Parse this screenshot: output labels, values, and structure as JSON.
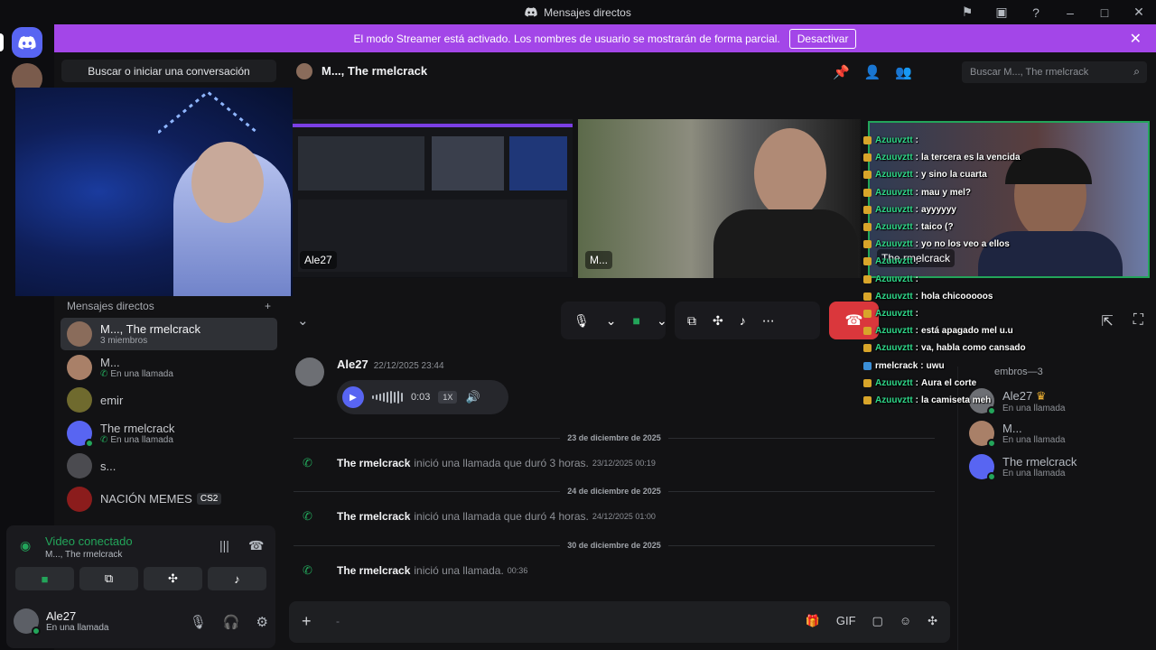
{
  "window": {
    "title": "Mensajes directos"
  },
  "banner": {
    "text": "El modo Streamer está activado. Los nombres de usuario se mostrarán de forma parcial.",
    "button": "Desactivar"
  },
  "sidebar": {
    "search_placeholder": "Buscar o iniciar una conversación",
    "dm_header": "Mensajes directos",
    "dms": [
      {
        "name": "M..., The rmelcrack",
        "sub": "3 miembros"
      },
      {
        "name": "M...",
        "sub": "En una llamada"
      },
      {
        "name": "emir",
        "sub": ""
      },
      {
        "name": "The rmelcrack",
        "sub": "En una llamada"
      },
      {
        "name": "s...",
        "sub": ""
      },
      {
        "name": "NACIÓN MEMES",
        "sub": "",
        "tag": "CS2"
      }
    ],
    "voice": {
      "title": "Video conectado",
      "sub": "M..., The rmelcrack"
    },
    "user": {
      "name": "Ale27",
      "status": "En una llamada"
    }
  },
  "channel": {
    "title": "M..., The rmelcrack",
    "search_placeholder": "Buscar M..., The rmelcrack"
  },
  "call": {
    "tiles": [
      {
        "label": "Ale27"
      },
      {
        "label": "M..."
      },
      {
        "label": "The rmelcrack"
      }
    ]
  },
  "messages": {
    "voice_msg": {
      "author": "Ale27",
      "time": "22/12/2025 23:44",
      "duration": "0:03",
      "speed": "1X"
    },
    "dividers": [
      "23 de diciembre de 2025",
      "24 de diciembre de 2025",
      "30 de diciembre de 2025"
    ],
    "calls": [
      {
        "who": "The rmelcrack",
        "text": "inició una llamada que duró 3 horas.",
        "time": "23/12/2025 00:19"
      },
      {
        "who": "The rmelcrack",
        "text": "inició una llamada que duró 4 horas.",
        "time": "24/12/2025 01:00"
      },
      {
        "who": "The rmelcrack",
        "text": "inició una llamada.",
        "time": "00:36"
      }
    ]
  },
  "members": {
    "header": "embros—3",
    "list": [
      {
        "name": "Ale27",
        "sub": "En una llamada",
        "crown": true
      },
      {
        "name": "M...",
        "sub": "En una llamada"
      },
      {
        "name": "The rmelcrack",
        "sub": "En una llamada"
      }
    ]
  },
  "chat_overlay": [
    {
      "user": "Azuuvztt",
      "msg": ""
    },
    {
      "user": "Azuuvztt",
      "msg": "la tercera es la vencida"
    },
    {
      "user": "Azuuvztt",
      "msg": "y sino la cuarta"
    },
    {
      "user": "Azuuvztt",
      "msg": "mau y mel?"
    },
    {
      "user": "Azuuvztt",
      "msg": "ayyyyyy"
    },
    {
      "user": "Azuuvztt",
      "msg": "taico (?"
    },
    {
      "user": "Azuuvztt",
      "msg": "yo no los veo a ellos"
    },
    {
      "user": "Azuuvztt",
      "msg": ""
    },
    {
      "user": "Azuuvztt",
      "msg": ""
    },
    {
      "user": "Azuuvztt",
      "msg": "hola chicooooos"
    },
    {
      "user": "Azuuvztt",
      "msg": ""
    },
    {
      "user": "Azuuvztt",
      "msg": "está apagado mel u.u"
    },
    {
      "user": "Azuuvztt",
      "msg": "va, habla como cansado"
    },
    {
      "user": "rmelcrack",
      "msg": "uwu"
    },
    {
      "user": "Azuuvztt",
      "msg": "Aura el corte"
    },
    {
      "user": "Azuuvztt",
      "msg": "la camiseta meh"
    }
  ]
}
